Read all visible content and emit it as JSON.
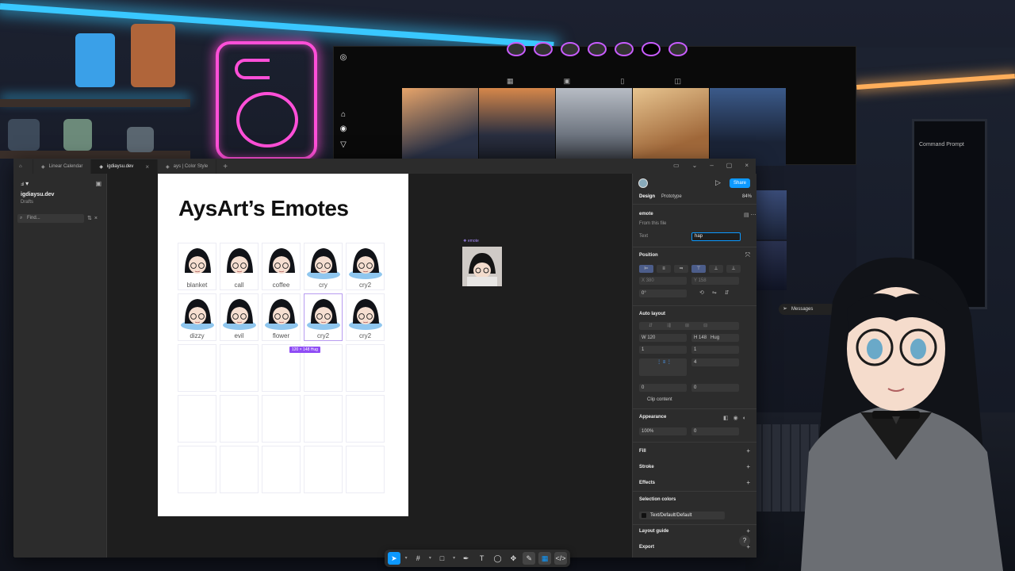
{
  "figma": {
    "tabs": [
      {
        "label": "Linear Calendar",
        "active": false
      },
      {
        "label": "igdiaysu.dev",
        "active": true
      },
      {
        "label": "ays | Color Style",
        "active": false
      }
    ],
    "left_panel": {
      "file_name": "igdiaysu.dev",
      "file_location": "Drafts",
      "find_placeholder": "Find..."
    },
    "canvas": {
      "frame_title": "AysArt’s Emotes",
      "emotes": [
        {
          "label": "blanket"
        },
        {
          "label": "call"
        },
        {
          "label": "coffee"
        },
        {
          "label": "cry"
        },
        {
          "label": "cry2"
        },
        {
          "label": "dizzy"
        },
        {
          "label": "evil"
        },
        {
          "label": "flower"
        },
        {
          "label": "cry2",
          "selected": true
        },
        {
          "label": "cry2"
        }
      ],
      "empty_rows": 3,
      "selection_size": "120 × 148 Hug",
      "side_component_label": "❖ emote"
    },
    "toolbar": {
      "tools": [
        "move-icon",
        "frame-icon",
        "shape-icon",
        "pen-icon",
        "text-icon",
        "comment-icon",
        "actions-icon"
      ]
    },
    "right_panel": {
      "share_label": "Share",
      "tabs": [
        "Design",
        "Prototype"
      ],
      "zoom": "84%",
      "component_name": "emote",
      "component_source": "From this file",
      "text_prop_label": "Text",
      "text_prop_value": "hap",
      "position_title": "Position",
      "x_label": "X",
      "x_value": "380",
      "y_label": "Y",
      "y_value": "158",
      "rotation": "0°",
      "auto_layout_title": "Auto layout",
      "width_label": "W",
      "width_value": "120",
      "height_label": "H",
      "height_value": "148",
      "height_mode": "Hug",
      "gap_a": "1",
      "gap_b": "1",
      "spacing": "4",
      "pad_a": "0",
      "pad_b": "0",
      "clip_content": "Clip content",
      "appearance_title": "Appearance",
      "opacity": "100%",
      "radius": "0",
      "fill_title": "Fill",
      "stroke_title": "Stroke",
      "effects_title": "Effects",
      "selection_colors_title": "Selection colors",
      "selection_color_name": "Text/Default/Default",
      "layout_guide_title": "Layout guide",
      "export_title": "Export"
    }
  },
  "overlay": {
    "messages_label": "Messages",
    "terminal_title": "Command Prompt"
  },
  "colors": {
    "figma_accent": "#0d99ff",
    "selection_purple": "#8f4cf5",
    "neon_pink": "#ff4fd8",
    "neon_blue": "#39c8ff"
  }
}
